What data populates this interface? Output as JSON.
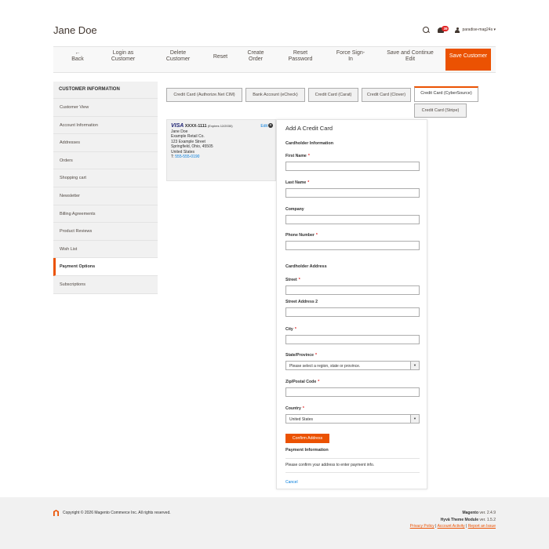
{
  "header": {
    "title": "Jane Doe",
    "notification_count": "39",
    "username": "paradise-mag24s ▾"
  },
  "actions": {
    "back": "←\nBack",
    "login_as": "Login as Customer",
    "delete": "Delete Customer",
    "reset": "Reset",
    "create_order": "Create Order",
    "reset_password": "Reset Password",
    "force_signin": "Force Sign-In",
    "save_continue": "Save and Continue Edit",
    "save": "Save Customer"
  },
  "sidebar": {
    "title": "CUSTOMER INFORMATION",
    "items": [
      "Customer View",
      "Account Information",
      "Addresses",
      "Orders",
      "Shopping cart",
      "Newsletter",
      "Billing Agreements",
      "Product Reviews",
      "Wish List",
      "Payment Options",
      "Subscriptions"
    ]
  },
  "tabs": [
    "Credit Card (Authorize.Net CIM)",
    "Bank Account (eCheck)",
    "Credit Card (Carat)",
    "Credit Card (Clover)",
    "Credit Card (CyberSource)",
    "Credit Card (Stripe)"
  ],
  "saved_card": {
    "brand": "VISA",
    "number": "XXXX-1111",
    "expires": "(Expires 12/2030)",
    "edit": "Edit",
    "lines": [
      "Jane Doe",
      "Example Retail Co.",
      "123 Example Street",
      "Springfield, Ohio, 45505",
      "United States"
    ],
    "phone_prefix": "T: ",
    "phone": "555-555-0190"
  },
  "form": {
    "title": "Add A Credit Card",
    "cardholder_info": "Cardholder Information",
    "first_name": "First Name",
    "last_name": "Last Name",
    "company": "Company",
    "phone": "Phone Number",
    "cardholder_address": "Cardholder Address",
    "street": "Street",
    "street2": "Street Address 2",
    "city": "City",
    "state": "State/Province",
    "state_placeholder": "Please select a region, state or province.",
    "zip": "Zip/Postal Code",
    "country": "Country",
    "country_value": "United States",
    "confirm": "Confirm Address",
    "payment_info": "Payment Information",
    "payment_note": "Please confirm your address to enter payment info.",
    "cancel": "Cancel",
    "required_mark": "*"
  },
  "footer": {
    "copyright": "Copyright © 2026 Magento Commerce Inc. All rights reserved.",
    "magento": "Magento",
    "magento_ver": " ver. 2.4.9",
    "hyva": "Hyvä Theme Module",
    "hyva_ver": " ver. 1.5.2",
    "privacy": "Privacy Policy",
    "activity": "Account Activity",
    "issue": "Report an Issue",
    "sep": " | "
  },
  "colors": {
    "accent": "#eb5202",
    "link": "#007bdb"
  }
}
